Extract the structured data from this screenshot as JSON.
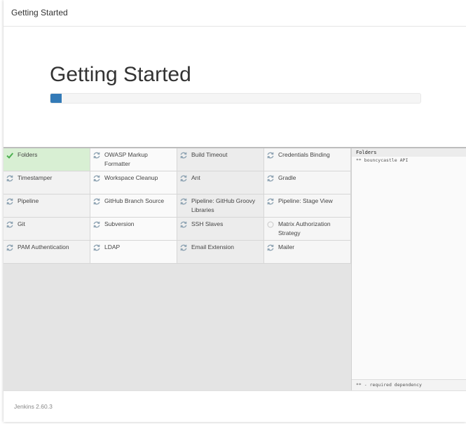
{
  "window": {
    "title": "Getting Started"
  },
  "hero": {
    "heading": "Getting Started",
    "progress": 0.03,
    "progress_color": "#337ab7"
  },
  "plugins": [
    {
      "name": "Folders",
      "status": "success"
    },
    {
      "name": "OWASP Markup Formatter",
      "status": "installing"
    },
    {
      "name": "Build Timeout",
      "status": "installing"
    },
    {
      "name": "Credentials Binding",
      "status": "installing"
    },
    {
      "name": "Timestamper",
      "status": "installing"
    },
    {
      "name": "Workspace Cleanup",
      "status": "installing"
    },
    {
      "name": "Ant",
      "status": "installing"
    },
    {
      "name": "Gradle",
      "status": "installing"
    },
    {
      "name": "Pipeline",
      "status": "installing"
    },
    {
      "name": "GitHub Branch Source",
      "status": "installing"
    },
    {
      "name": "Pipeline: GitHub Groovy Libraries",
      "status": "installing"
    },
    {
      "name": "Pipeline: Stage View",
      "status": "installing"
    },
    {
      "name": "Git",
      "status": "installing"
    },
    {
      "name": "Subversion",
      "status": "installing"
    },
    {
      "name": "SSH Slaves",
      "status": "installing"
    },
    {
      "name": "Matrix Authorization Strategy",
      "status": "pending"
    },
    {
      "name": "PAM Authentication",
      "status": "installing"
    },
    {
      "name": "LDAP",
      "status": "installing"
    },
    {
      "name": "Email Extension",
      "status": "installing"
    },
    {
      "name": "Mailer",
      "status": "installing"
    }
  ],
  "log": {
    "header": "Folders",
    "lines": [
      "** bouncycastle API"
    ],
    "footer": "** - required dependency"
  },
  "footer": {
    "version": "Jenkins 2.60.3"
  },
  "icons": {
    "success": "check-icon",
    "installing": "refresh-icon",
    "pending": "empty-circle-icon"
  },
  "colors": {
    "success_bg": "#d8efd3",
    "check": "#4caf50",
    "spinner": "#8aa0b0"
  }
}
